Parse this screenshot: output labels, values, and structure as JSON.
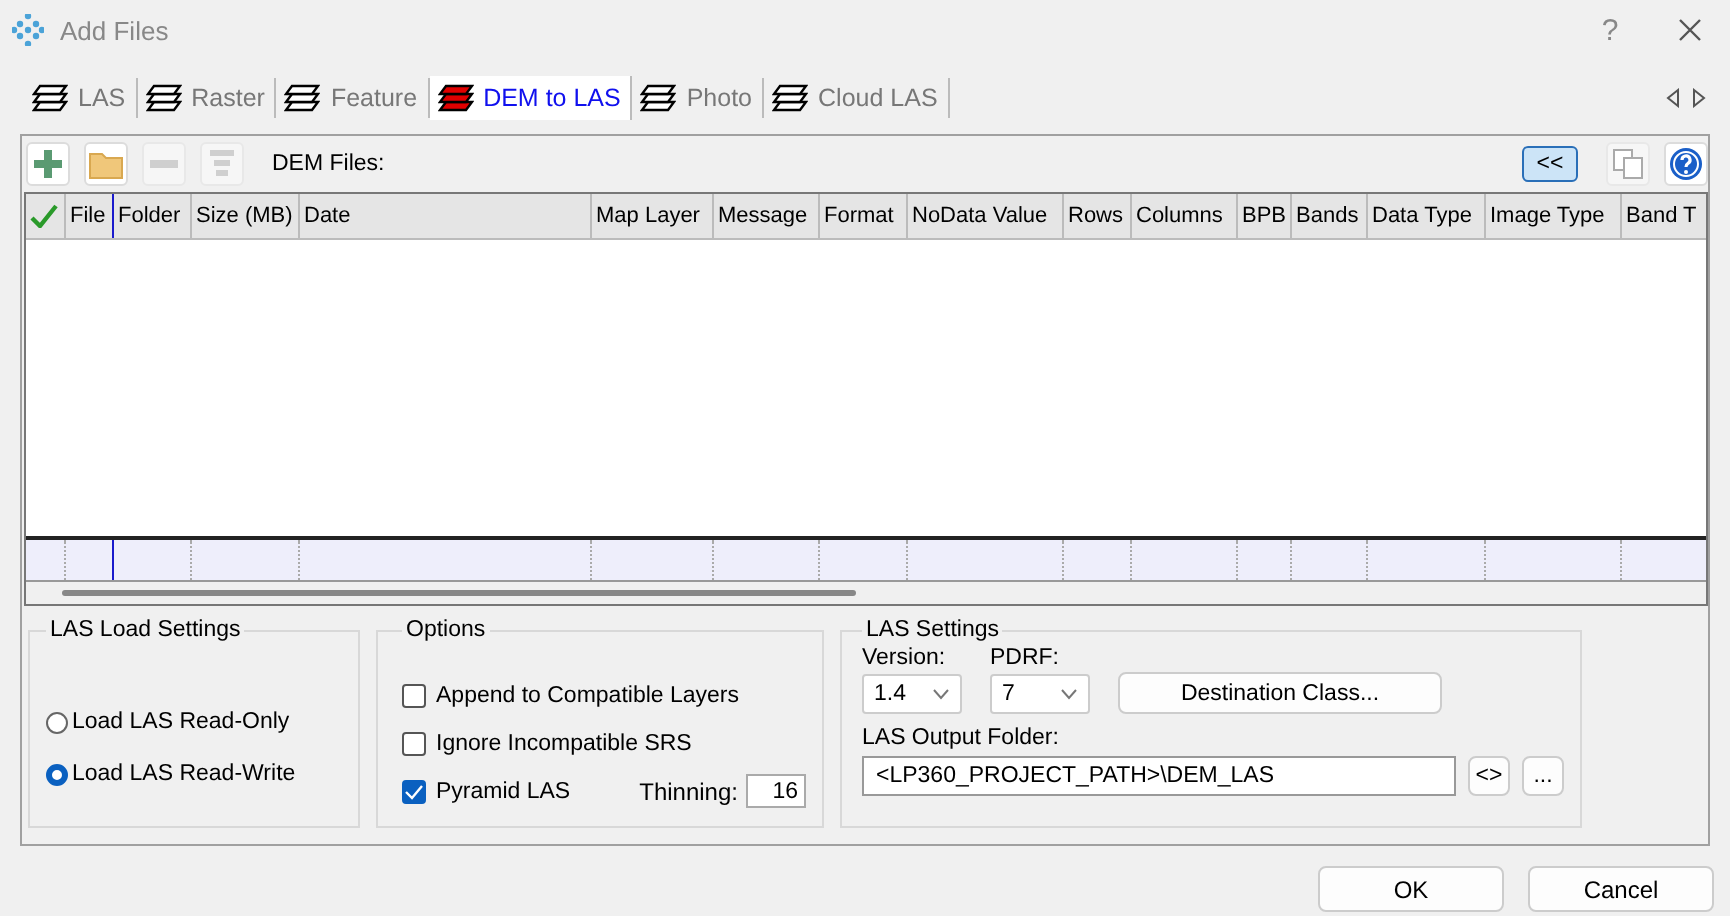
{
  "window": {
    "title": "Add Files",
    "help": "?"
  },
  "tabs": [
    {
      "label": "LAS",
      "selected": false
    },
    {
      "label": "Raster",
      "selected": false
    },
    {
      "label": "Feature",
      "selected": false
    },
    {
      "label": "DEM to LAS",
      "selected": true
    },
    {
      "label": "Photo",
      "selected": false
    },
    {
      "label": "Cloud LAS",
      "selected": false
    }
  ],
  "toolbar": {
    "tools": [
      {
        "kind": "add",
        "disabled": false
      },
      {
        "kind": "folder",
        "disabled": false
      },
      {
        "kind": "remove",
        "disabled": true
      },
      {
        "kind": "filter",
        "disabled": true
      }
    ],
    "label": "DEM Files:",
    "collapse": {
      "label": "<<",
      "selected": true
    },
    "right_tools": [
      {
        "kind": "copy",
        "disabled": true
      },
      {
        "kind": "help",
        "disabled": false
      }
    ]
  },
  "table": {
    "columns": [
      "",
      "File",
      "Folder",
      "Size (MB)",
      "Date",
      "Map Layer",
      "Message",
      "Format",
      "NoData Value",
      "Rows",
      "Columns",
      "BPB",
      "Bands",
      "Data Type",
      "Image Type",
      "Band T"
    ]
  },
  "load_settings": {
    "title": "LAS Load Settings",
    "options": [
      {
        "label": "Load LAS Read-Only",
        "selected": false
      },
      {
        "label": "Load LAS Read-Write",
        "selected": true
      }
    ]
  },
  "options": {
    "title": "Options",
    "checks": [
      {
        "label": "Append to Compatible Layers",
        "checked": false
      },
      {
        "label": "Ignore Incompatible SRS",
        "checked": false
      },
      {
        "label": "Pyramid LAS",
        "checked": true
      }
    ],
    "thinning_label": "Thinning:",
    "thinning": "16"
  },
  "las_settings": {
    "title": "LAS Settings",
    "version_label": "Version:",
    "version": "1.4",
    "pdrf_label": "PDRF:",
    "pdrf": "7",
    "destination_button": "Destination Class...",
    "output_label": "LAS Output Folder:",
    "output_folder": "<LP360_PROJECT_PATH>\\DEM_LAS",
    "variable_button": "<>",
    "browse_button": "..."
  },
  "buttons": [
    "OK",
    "Cancel"
  ]
}
